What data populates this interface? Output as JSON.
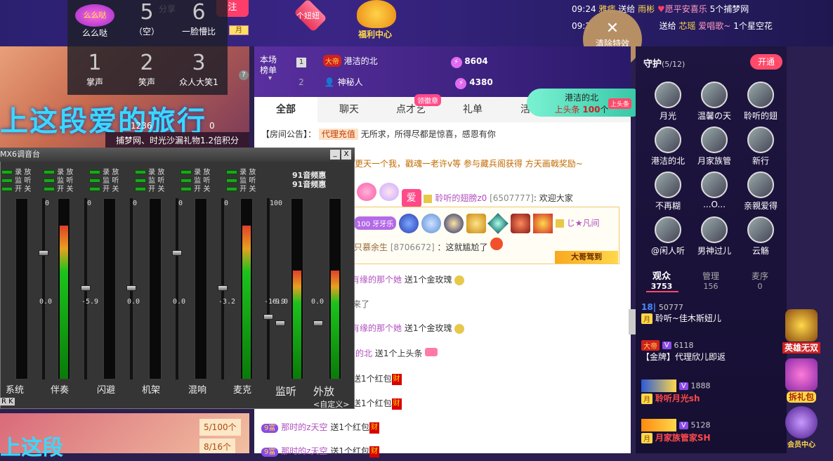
{
  "topbar": {
    "share": "分享",
    "follow": "注",
    "month": "月",
    "button_niu": "个妞妞",
    "welfare": "福利中心",
    "notices": [
      {
        "time": "09:24",
        "user": "雅痞",
        "action": "送给",
        "target": "雨彬",
        "gift": "愿平安喜乐",
        "count": "5个捕梦网"
      },
      {
        "time": "09:2",
        "action": "送给",
        "target": "芯瑶",
        "gift": "爱唱歌~",
        "count": "1个星空花"
      }
    ],
    "clear_effects": "清除特效"
  },
  "emoji_panel": {
    "items": [
      {
        "num": "",
        "label": "么么哒"
      },
      {
        "num": "5",
        "label": "（空）"
      },
      {
        "num": "6",
        "label": "一脸懵比"
      },
      {
        "num": "1",
        "label": "掌声"
      },
      {
        "num": "2",
        "label": "笑声"
      },
      {
        "num": "3",
        "label": "众人大笑1"
      }
    ],
    "sticker_text": "么么哒"
  },
  "banner": {
    "text": "上这段爱的旅行",
    "count1": "1236",
    "count2": "0",
    "strip": "捕梦网、时光沙漏礼物1.2倍积分",
    "text2": "上这段",
    "progress1": "5/100个",
    "progress2": "8/16个"
  },
  "rank": {
    "label": "本场榜单",
    "rows": [
      {
        "rank": "1",
        "title": "大帝",
        "name": "港洁的北",
        "score": "8604"
      },
      {
        "rank": "2",
        "name": "神秘人",
        "score": "4380"
      }
    ]
  },
  "headline": {
    "name": "港洁的北",
    "text": "上头条",
    "count": "100",
    "unit": "个",
    "tag": "上头条"
  },
  "tabs": [
    "全部",
    "聊天",
    "点才艺",
    "礼单",
    "活"
  ],
  "tab_badge": "领徽章",
  "chat": {
    "announcement_label": "【房间公告】：",
    "announcement_tag": "代理充值",
    "announcement_text": "无所求，所得尽都是惊喜，感恩有你",
    "promo": "更天一个我，戳魂一老许v等 参与藏兵阁获得 方天画戟奖励~",
    "welcome_user": "聆听的翅膀z0",
    "welcome_id": "[6507777]",
    "welcome_text": "欢迎大家",
    "love": "爱",
    "vip_user": "じ★凡间",
    "vip_tag": "牙牙乐",
    "vip_level": "100",
    "msg_user": "只慕余生",
    "msg_id": "[8706672]",
    "msg_text": "：这就尴尬了",
    "vip_arrive": "大哥驾到",
    "lines": [
      {
        "user": "有缘的那个她",
        "action": "送1个金玫瑰"
      },
      {
        "user": "",
        "action": "来了"
      },
      {
        "user": "有缘的那个她",
        "action": "送1个金玫瑰"
      },
      {
        "user": "的北",
        "action": "送1个上头条"
      },
      {
        "user": "",
        "action": "送1个红包"
      },
      {
        "user": "",
        "action": "送1个红包"
      },
      {
        "user": "那时的z天空",
        "action": "送1个红包",
        "level": "9富"
      },
      {
        "user": "那时的z天空",
        "action": "送1个红包",
        "level": "9富"
      }
    ],
    "red_label": "财"
  },
  "mixer": {
    "title": "MX6调音台",
    "min_btn": "_",
    "close_btn": "X",
    "switch_labels": [
      "录",
      "放",
      "监",
      "听",
      "开",
      "关"
    ],
    "freq1": "91音频惠",
    "freq2": "91音频惠",
    "channels": [
      {
        "name": "系统",
        "top": "0",
        "val": "0.0"
      },
      {
        "name": "伴奏",
        "top": "0",
        "val": "-5.9"
      },
      {
        "name": "闪避",
        "top": "0",
        "val": "0.0"
      },
      {
        "name": "机架",
        "top": "0",
        "val": "0.0"
      },
      {
        "name": "混响",
        "top": "0",
        "val": "-3.2"
      },
      {
        "name": "麦克",
        "top": "100",
        "mid": "100",
        "val": "-16.9"
      }
    ],
    "monitor": "监听",
    "output": "外放",
    "monitor_val": "-9.0",
    "output_val": "0.0",
    "scale": [
      "0",
      "12",
      "24",
      "36",
      "48",
      "60",
      "72"
    ],
    "bottom_left": "R K",
    "custom": "<自定义>"
  },
  "right": {
    "guard_label": "守护",
    "guard_count": "(5/12)",
    "open_btn": "开通",
    "guards": [
      "月光",
      "温馨の天",
      "聆听的翅",
      "港洁的北",
      "月家族管",
      "新行",
      "不再糊",
      "...O...",
      "亲親爱得",
      "@闲人听",
      "男神过儿",
      "云觞"
    ],
    "tab_viewers": "观众",
    "viewers_count": "3753",
    "tab_admin": "管理",
    "admin_count": "156",
    "tab_seats": "麦序",
    "seats_count": "0",
    "viewers": [
      {
        "id": "50777",
        "name": "聆听~佳木斯妞儿",
        "badge": "月"
      },
      {
        "id": "6118",
        "name": "【金牌】代理欣儿即返",
        "badge": "大帝"
      },
      {
        "id": "1888",
        "name": "聆听月光sh",
        "badge": "月"
      },
      {
        "id": "5128",
        "name": "月家族管家SH",
        "badge": "月"
      }
    ],
    "hero": "英雄无双",
    "gift_pack": "拆礼包",
    "member": "会员中心"
  }
}
